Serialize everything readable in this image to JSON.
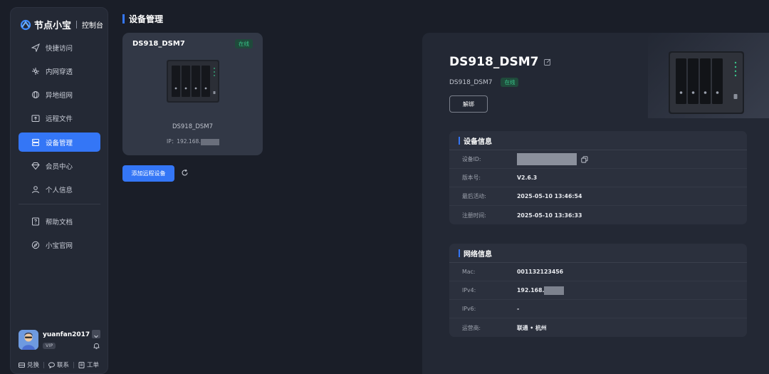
{
  "sidebar": {
    "logo_text": "节点小宝",
    "logo_sub": "控制台",
    "items": [
      {
        "label": "快捷访问",
        "icon": "send-icon"
      },
      {
        "label": "内网穿透",
        "icon": "network-icon"
      },
      {
        "label": "异地组网",
        "icon": "globe-network-icon"
      },
      {
        "label": "远程文件",
        "icon": "folder-upload-icon"
      },
      {
        "label": "设备管理",
        "icon": "server-icon",
        "active": true
      },
      {
        "label": "会员中心",
        "icon": "diamond-icon"
      },
      {
        "label": "个人信息",
        "icon": "user-icon"
      }
    ],
    "items2": [
      {
        "label": "帮助文档",
        "icon": "help-doc-icon"
      },
      {
        "label": "小宝官网",
        "icon": "compass-icon"
      }
    ],
    "user": {
      "name": "yuanfan2017",
      "badge": "VIP"
    },
    "links": [
      {
        "label": "兑换",
        "icon": "redeem-icon"
      },
      {
        "label": "联系",
        "icon": "chat-icon"
      },
      {
        "label": "工单",
        "icon": "ticket-icon"
      }
    ]
  },
  "page": {
    "title": "设备管理"
  },
  "device_card": {
    "name": "DS918_DSM7",
    "status": "在线",
    "label": "DS918_DSM7",
    "ip_prefix": "IP：192.168."
  },
  "actions": {
    "add_device": "添加远程设备"
  },
  "detail": {
    "title": "DS918_DSM7",
    "subtitle": "DS918_DSM7",
    "status": "在线",
    "unbind": "解绑",
    "device_info": {
      "heading": "设备信息",
      "rows": [
        {
          "key": "设备ID:",
          "value": ""
        },
        {
          "key": "版本号:",
          "value": "V2.6.3"
        },
        {
          "key": "最后活动:",
          "value": "2025-05-10 13:46:54"
        },
        {
          "key": "注册时间:",
          "value": "2025-05-10 13:36:33"
        }
      ]
    },
    "network_info": {
      "heading": "网络信息",
      "rows": [
        {
          "key": "Mac:",
          "value": "001132123456"
        },
        {
          "key": "IPv4:",
          "value": "192.168."
        },
        {
          "key": "IPv6:",
          "value": "-"
        },
        {
          "key": "运营商:",
          "value": "联通 • 杭州"
        }
      ]
    }
  },
  "colors": {
    "accent": "#3476f6",
    "online": "#38c58a",
    "background": "#1a1e28"
  }
}
